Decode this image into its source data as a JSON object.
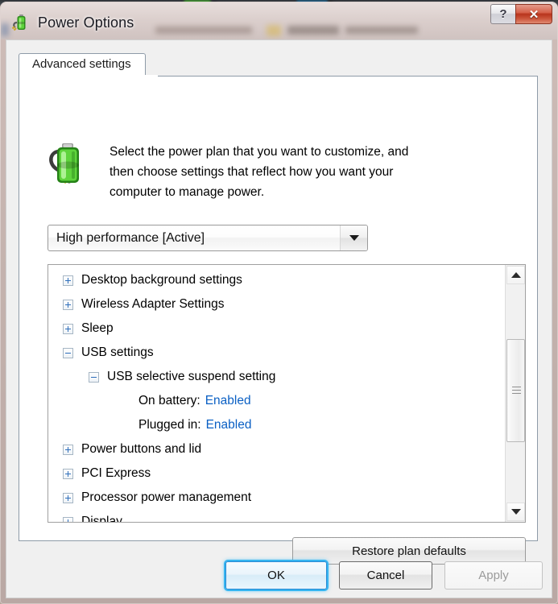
{
  "window": {
    "title": "Power Options",
    "icon": "power-plug-battery-icon",
    "help_label": "?",
    "close_label": "✕"
  },
  "tabs": [
    {
      "label": "Advanced settings",
      "active": true
    }
  ],
  "header": {
    "icon": "battery-plug-icon",
    "description": "Select the power plan that you want to customize, and then choose settings that reflect how you want your computer to manage power."
  },
  "plan_select": {
    "value": "High performance [Active]",
    "caret_icon": "chevron-down-icon"
  },
  "settings_tree": [
    {
      "level": 0,
      "expander": "plus",
      "label": "Desktop background settings"
    },
    {
      "level": 0,
      "expander": "plus",
      "label": "Wireless Adapter Settings"
    },
    {
      "level": 0,
      "expander": "plus",
      "label": "Sleep"
    },
    {
      "level": 0,
      "expander": "minus",
      "label": "USB settings"
    },
    {
      "level": 1,
      "expander": "minus",
      "label": "USB selective suspend setting"
    },
    {
      "level": 2,
      "expander": "none",
      "label": "On battery:",
      "value": "Enabled"
    },
    {
      "level": 2,
      "expander": "none",
      "label": "Plugged in:",
      "value": "Enabled"
    },
    {
      "level": 0,
      "expander": "plus",
      "label": "Power buttons and lid"
    },
    {
      "level": 0,
      "expander": "plus",
      "label": "PCI Express"
    },
    {
      "level": 0,
      "expander": "plus",
      "label": "Processor power management"
    },
    {
      "level": 0,
      "expander": "plus",
      "label": "Display"
    }
  ],
  "scrollbar": {
    "up_icon": "scroll-up-arrow-icon",
    "down_icon": "scroll-down-arrow-icon",
    "thumb_icon": "scroll-thumb-grip-icon"
  },
  "buttons": {
    "restore": "Restore plan defaults",
    "ok": "OK",
    "cancel": "Cancel",
    "apply": "Apply",
    "apply_disabled": true
  },
  "colors": {
    "link": "#0b60c4",
    "close_button": "#b8341c",
    "focus_glow": "#36b5f0",
    "dialog_bg": "#f0f0f0",
    "tab_border": "#8e9ba8"
  }
}
